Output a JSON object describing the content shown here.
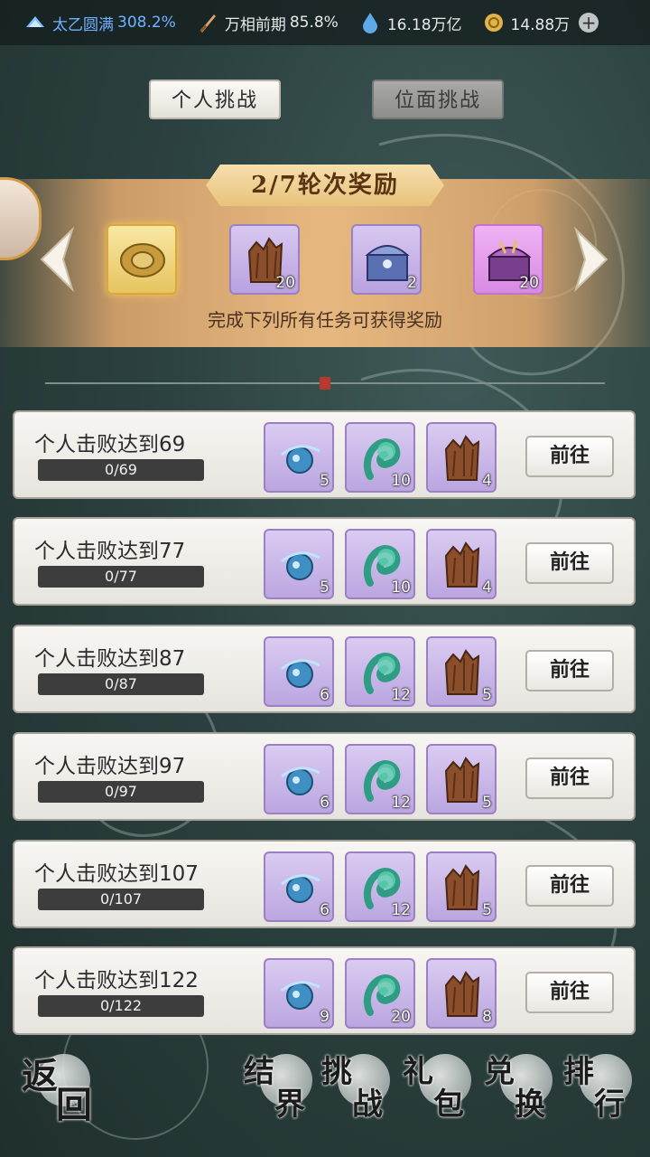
{
  "status": {
    "realm": {
      "label": "太乙圆满",
      "value": "308.2%"
    },
    "phase": {
      "label": "万相前期",
      "value": "85.8%"
    },
    "spirit_stones": "16.18万亿",
    "gold": "14.88万"
  },
  "tabs": [
    {
      "label": "个人挑战",
      "active": true
    },
    {
      "label": "位面挑战",
      "active": false
    }
  ],
  "banner": {
    "round_title": "2/7轮次奖励",
    "note": "完成下列所有任务可获得奖励",
    "rewards": [
      {
        "icon": "golden-talisman-icon",
        "qty": ""
      },
      {
        "icon": "wood-stump-icon",
        "qty": "20"
      },
      {
        "icon": "blue-treasure-chest-icon",
        "qty": "2"
      },
      {
        "icon": "purple-treasure-chest-icon",
        "qty": "20"
      }
    ]
  },
  "tasks": [
    {
      "title": "个人击败达到69",
      "progress": "0/69",
      "items": [
        "5",
        "10",
        "4"
      ],
      "button": "前往"
    },
    {
      "title": "个人击败达到77",
      "progress": "0/77",
      "items": [
        "5",
        "10",
        "4"
      ],
      "button": "前往"
    },
    {
      "title": "个人击败达到87",
      "progress": "0/87",
      "items": [
        "6",
        "12",
        "5"
      ],
      "button": "前往"
    },
    {
      "title": "个人击败达到97",
      "progress": "0/97",
      "items": [
        "6",
        "12",
        "5"
      ],
      "button": "前往"
    },
    {
      "title": "个人击败达到107",
      "progress": "0/107",
      "items": [
        "6",
        "12",
        "5"
      ],
      "button": "前往"
    },
    {
      "title": "个人击败达到122",
      "progress": "0/122",
      "items": [
        "9",
        "20",
        "8"
      ],
      "button": "前往"
    }
  ],
  "task_item_icons": [
    "blue-spirit-orb-icon",
    "green-spirit-wisp-icon",
    "wood-stump-icon"
  ],
  "nav": [
    {
      "c1": "返",
      "c2": "回"
    },
    {
      "c1": "结",
      "c2": "界"
    },
    {
      "c1": "挑",
      "c2": "战"
    },
    {
      "c1": "礼",
      "c2": "包"
    },
    {
      "c1": "兑",
      "c2": "换"
    },
    {
      "c1": "排",
      "c2": "行"
    }
  ],
  "colors": {
    "accent_blue": "#6fb3ff",
    "banner_gold": "#e9c27b",
    "item_purple": "#bba6e0"
  }
}
